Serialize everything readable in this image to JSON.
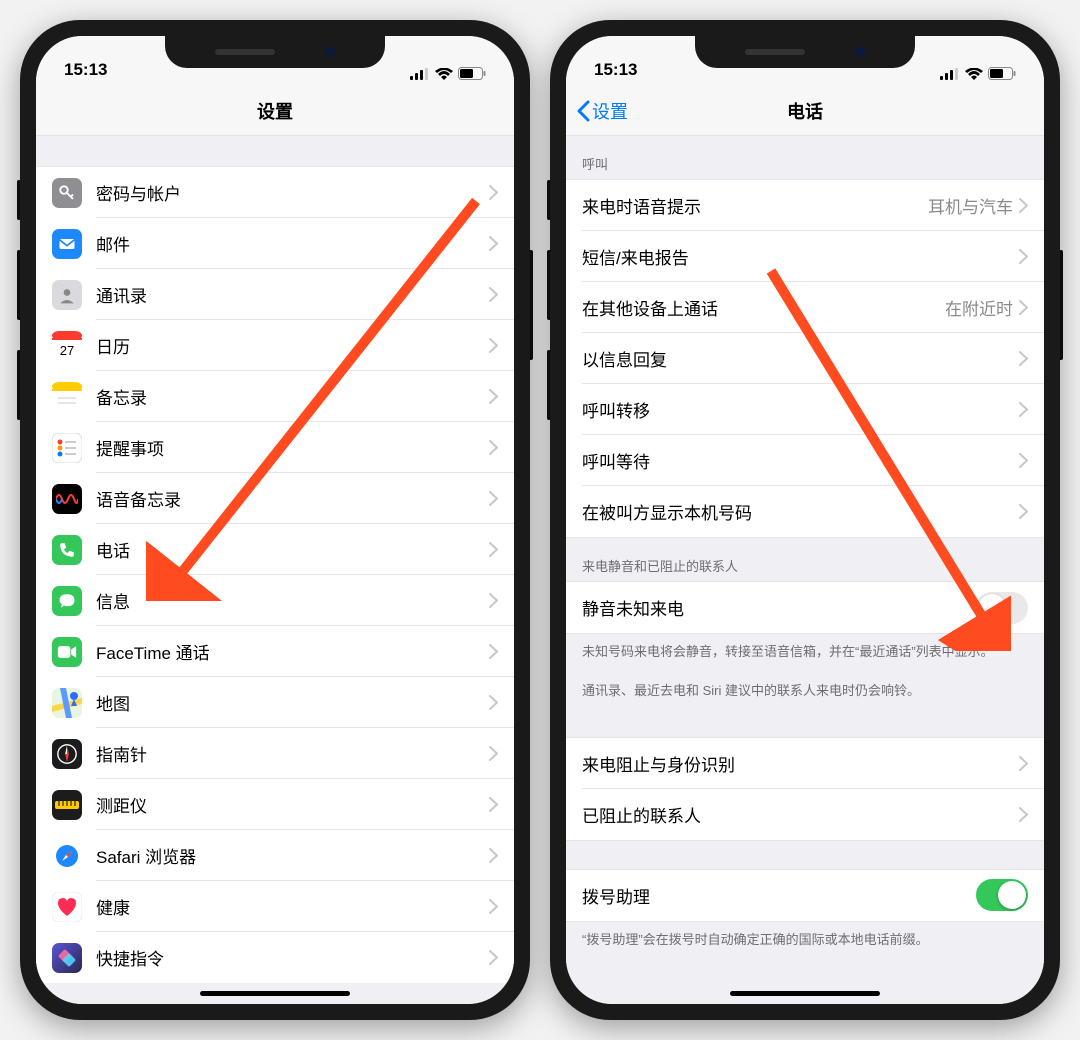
{
  "status": {
    "time": "15:13"
  },
  "left": {
    "nav_title": "设置",
    "rows": [
      {
        "key": "passwords",
        "label": "密码与帐户",
        "icon_bg": "#8e8e93",
        "icon": "key"
      },
      {
        "key": "mail",
        "label": "邮件",
        "icon_bg": "#1e88ff",
        "icon": "mail"
      },
      {
        "key": "contacts",
        "label": "通讯录",
        "icon_bg": "#d9d9de",
        "icon": "contact"
      },
      {
        "key": "calendar",
        "label": "日历",
        "icon_bg": "#ffffff",
        "icon": "calendar"
      },
      {
        "key": "notes",
        "label": "备忘录",
        "icon_bg": "#ffffff",
        "icon": "notes"
      },
      {
        "key": "reminders",
        "label": "提醒事项",
        "icon_bg": "#ffffff",
        "icon": "reminders"
      },
      {
        "key": "voicememo",
        "label": "语音备忘录",
        "icon_bg": "#000000",
        "icon": "voicememo"
      },
      {
        "key": "phone",
        "label": "电话",
        "icon_bg": "#34c759",
        "icon": "phone"
      },
      {
        "key": "messages",
        "label": "信息",
        "icon_bg": "#34c759",
        "icon": "message"
      },
      {
        "key": "facetime",
        "label": "FaceTime 通话",
        "icon_bg": "#34c759",
        "icon": "facetime"
      },
      {
        "key": "maps",
        "label": "地图",
        "icon_bg": "#ffffff",
        "icon": "maps"
      },
      {
        "key": "compass",
        "label": "指南针",
        "icon_bg": "#1c1c1e",
        "icon": "compass"
      },
      {
        "key": "measure",
        "label": "测距仪",
        "icon_bg": "#1c1c1e",
        "icon": "measure"
      },
      {
        "key": "safari",
        "label": "Safari 浏览器",
        "icon_bg": "#ffffff",
        "icon": "safari"
      },
      {
        "key": "health",
        "label": "健康",
        "icon_bg": "#ffffff",
        "icon": "health"
      },
      {
        "key": "shortcuts",
        "label": "快捷指令",
        "icon_bg": "#3a3750",
        "icon": "shortcuts"
      }
    ]
  },
  "right": {
    "nav_back": "设置",
    "nav_title": "电话",
    "sections": [
      {
        "header": "呼叫",
        "rows": [
          {
            "key": "announce",
            "label": "来电时语音提示",
            "value": "耳机与汽车",
            "type": "link"
          },
          {
            "key": "report",
            "label": "短信/来电报告",
            "type": "link"
          },
          {
            "key": "otherdev",
            "label": "在其他设备上通话",
            "value": "在附近时",
            "type": "link"
          },
          {
            "key": "respond",
            "label": "以信息回复",
            "type": "link"
          },
          {
            "key": "forward",
            "label": "呼叫转移",
            "type": "link"
          },
          {
            "key": "waiting",
            "label": "呼叫等待",
            "type": "link"
          },
          {
            "key": "callerid",
            "label": "在被叫方显示本机号码",
            "type": "link"
          }
        ]
      },
      {
        "header": "来电静音和已阻止的联系人",
        "rows": [
          {
            "key": "silence",
            "label": "静音未知来电",
            "type": "switch",
            "on": false
          }
        ],
        "footer": "未知号码来电将会静音，转接至语音信箱，并在“最近通话”列表中显示。\n\n通讯录、最近去电和 Siri 建议中的联系人来电时仍会响铃。"
      },
      {
        "rows": [
          {
            "key": "blockid",
            "label": "来电阻止与身份识别",
            "type": "link"
          },
          {
            "key": "blocked",
            "label": "已阻止的联系人",
            "type": "link"
          }
        ]
      },
      {
        "rows": [
          {
            "key": "dialassist",
            "label": "拨号助理",
            "type": "switch",
            "on": true
          }
        ],
        "footer": "“拨号助理”会在拨号时自动确定正确的国际或本地电话前缀。"
      }
    ]
  }
}
